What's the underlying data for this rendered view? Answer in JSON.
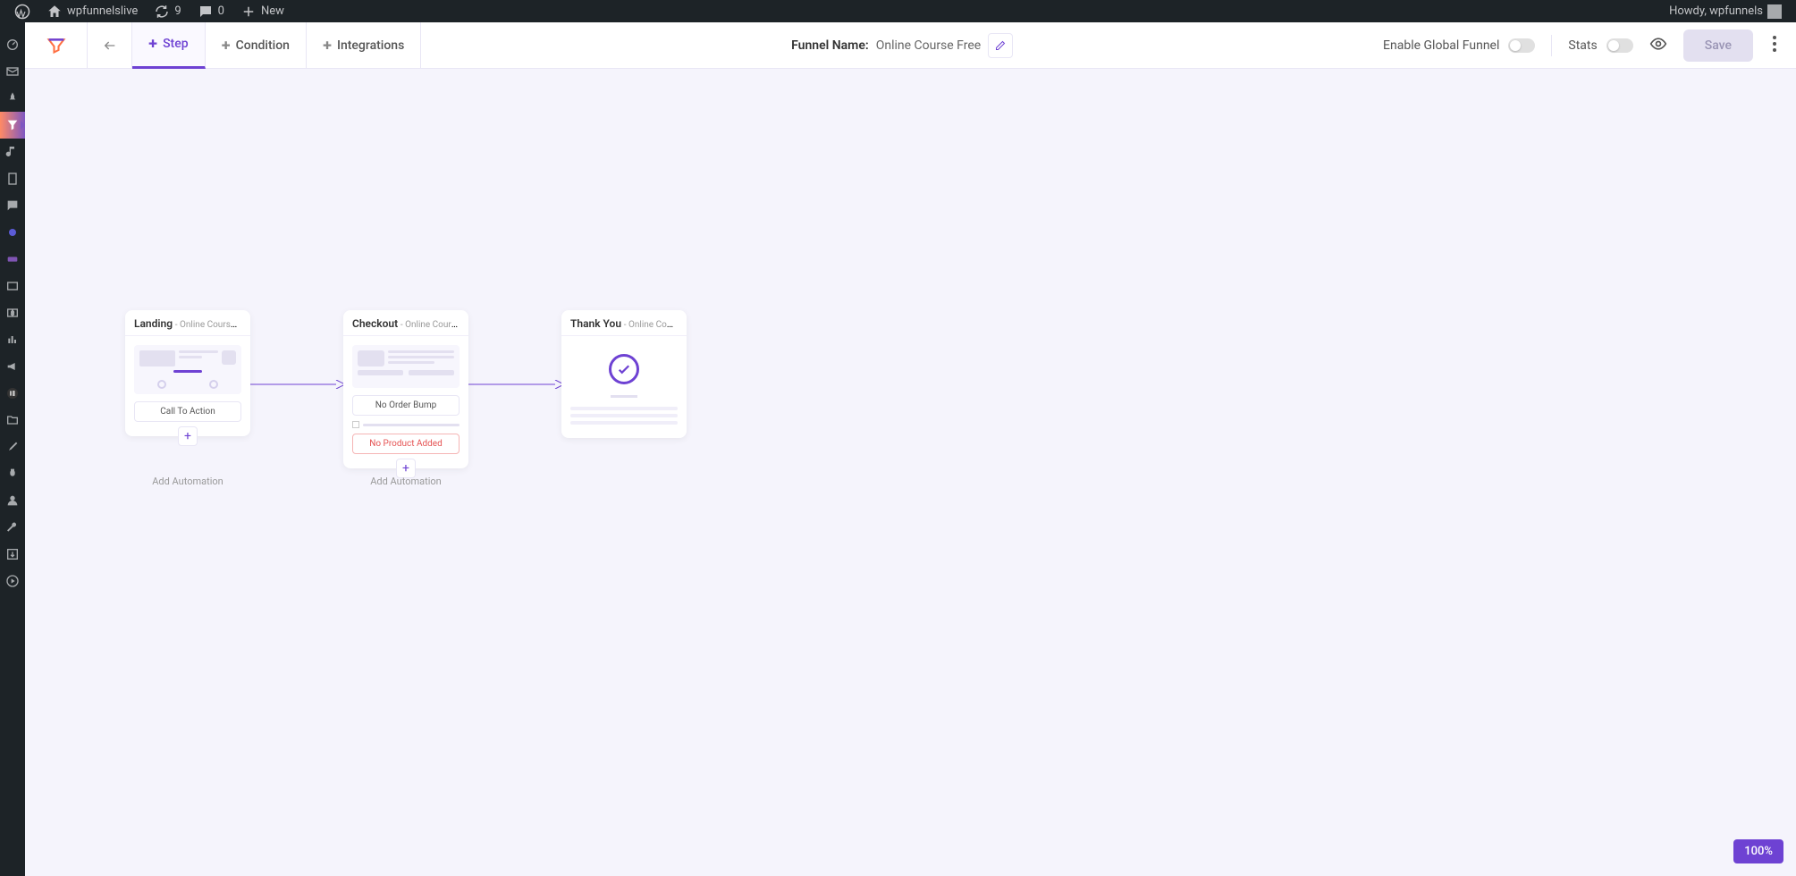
{
  "wp_bar": {
    "site_name": "wpfunnelslive",
    "updates": "9",
    "comments": "0",
    "new_label": "New",
    "greeting": "Howdy, wpfunnels"
  },
  "toolbar": {
    "tabs": {
      "step": "Step",
      "condition": "Condition",
      "integrations": "Integrations"
    },
    "funnel_name_label": "Funnel Name:",
    "funnel_name_value": "Online Course Free",
    "enable_global": "Enable Global Funnel",
    "stats": "Stats",
    "save": "Save"
  },
  "nodes": {
    "landing": {
      "title": "Landing",
      "subtitle": "- Online Course ...",
      "cta": "Call To Action",
      "add_automation": "Add Automation"
    },
    "checkout": {
      "title": "Checkout",
      "subtitle": "- Online Course ...",
      "no_bump": "No Order Bump",
      "no_product": "No Product Added",
      "add_automation": "Add Automation"
    },
    "thankyou": {
      "title": "Thank You",
      "subtitle": "- Online Course ..."
    }
  },
  "zoom": "100%"
}
